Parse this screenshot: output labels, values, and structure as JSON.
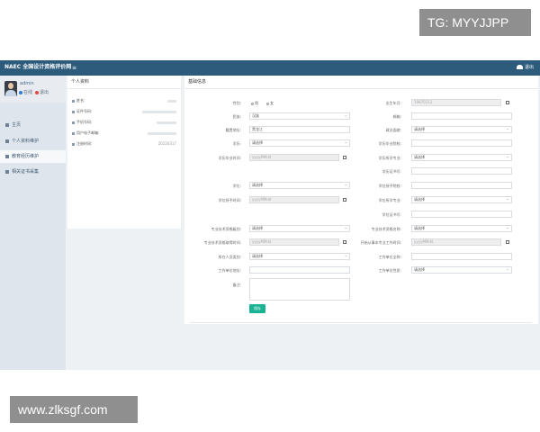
{
  "watermarks": {
    "top": "TG: MYYJJPP",
    "bottom": "www.zlksgf.com"
  },
  "topbar": {
    "brand": "NAEC 全国设计资格评价网",
    "menu_icon": "menu-icon",
    "user": "退出"
  },
  "sidebar": {
    "user_name": "admin",
    "status_online": "在线",
    "status_logout": "退出",
    "items": [
      {
        "label": "主页"
      },
      {
        "label": "个人资料维护"
      },
      {
        "label": "教育经历维护"
      },
      {
        "label": "相关证书采集"
      }
    ]
  },
  "profile_card": {
    "title": "个人资料",
    "rows": [
      {
        "label": "姓名:",
        "value": ""
      },
      {
        "label": "证件号码:",
        "value": ""
      },
      {
        "label": "手机号码:",
        "value": ""
      },
      {
        "label": "用户电子邮箱:",
        "value": ""
      },
      {
        "label": "注册时间:",
        "value": "20220317"
      }
    ]
  },
  "form": {
    "title": "基础信息",
    "gender_label": "性别:",
    "gender_male": "男",
    "gender_female": "女",
    "birth_label": "出生年月:",
    "birth_value": "19870312",
    "nation_label": "民族:",
    "nation_value": "汉族",
    "email_label": "邮箱:",
    "email_value": "",
    "native_label": "籍贯地址:",
    "native_value": "黑龙江",
    "politics_label": "政治面貌:",
    "politics_value": "请选择",
    "edu_label": "学历:",
    "edu_value": "请选择",
    "edu_school_label": "学历毕业院校:",
    "edu_school_value": "",
    "edu_time_label": "学历毕业时间:",
    "edu_time_value": "yyyyMMdd",
    "edu_major_label": "学历所学专业:",
    "edu_major_value": "请选择",
    "edu_cert_label": "学历证书号:",
    "edu_cert_value": "",
    "degree_label": "学位:",
    "degree_value": "请选择",
    "degree_school_label": "学位授予院校:",
    "degree_school_value": "",
    "degree_time_label": "学位授予时间:",
    "degree_time_value": "yyyyMMdd",
    "degree_major_label": "学位所学专业:",
    "degree_major_value": "请选择",
    "degree_cert_label": "学位证书号:",
    "degree_cert_value": "",
    "title_level_label": "专业技术资格级别:",
    "title_level_value": "请选择",
    "title_name_label": "专业技术资格名称:",
    "title_name_value": "请选择",
    "title_time_label": "专业技术资格取得时间:",
    "title_time_value": "yyyyMMdd",
    "work_start_label": "开始从事本专业工作时间:",
    "work_start_value": "yyyyMMdd",
    "personnel_label": "所在人员类别:",
    "personnel_value": "请选择",
    "work_unit_label": "工作单位全称:",
    "work_unit_value": "",
    "unit_addr_label": "工作单位地址:",
    "unit_addr_value": "",
    "unit_type_label": "工作单位性质:",
    "unit_type_value": "请选择",
    "remark_label": "备注:",
    "save_label": "保存"
  },
  "colors": {
    "topbar": "#2c5b7c",
    "accent": "#1ab394",
    "sidebar": "#dfe5ec"
  }
}
